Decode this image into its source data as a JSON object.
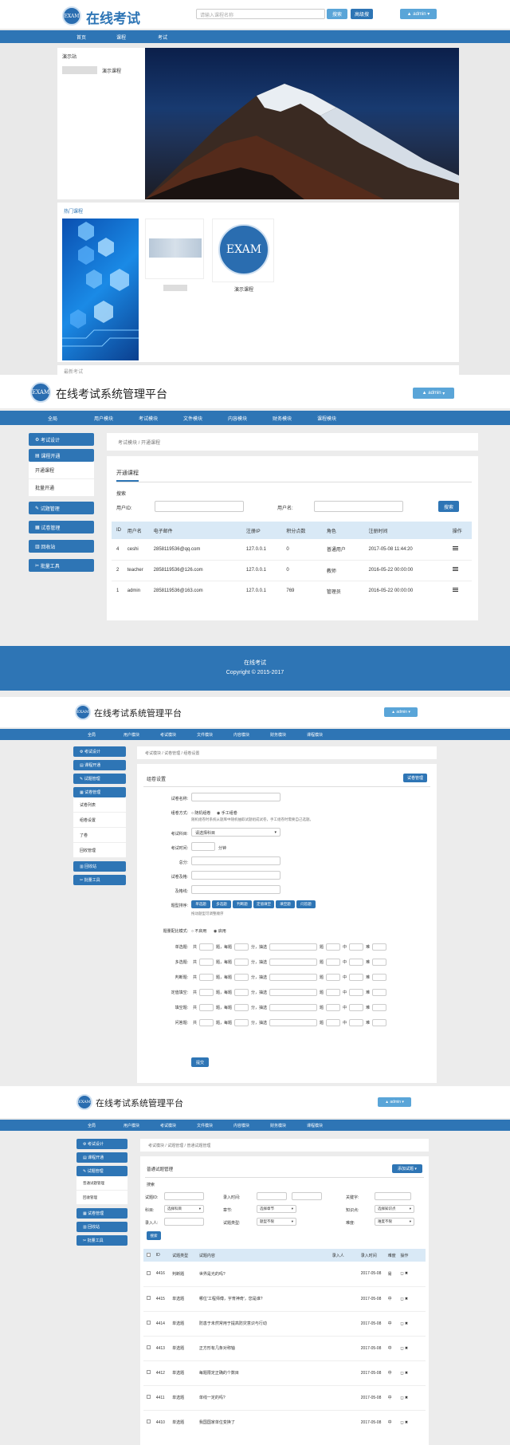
{
  "site": {
    "logo_text": "EXAM",
    "name": "在线考试",
    "search_placeholder": "请输入课程名称",
    "search_btn": "搜索",
    "search_btn2": "高级搜",
    "user_btn": "admin",
    "nav": [
      "首页",
      "课程",
      "考试"
    ],
    "sidebar_title": "演示站",
    "sidebar_item": "演示课程",
    "featured_title": "热门课程",
    "course_caption": "演示课程",
    "footer_cut": "最新考试"
  },
  "admin": {
    "logo_text": "EXAM",
    "title": "在线考试系统管理平台",
    "user_btn": "admin",
    "nav": [
      "全局",
      "用户模块",
      "考试模块",
      "文件模块",
      "内容模块",
      "财务模块",
      "课程模块"
    ],
    "sidebar": [
      "考试设计",
      "课程开通",
      "开通课程",
      "批量开通",
      "试题管理",
      "试卷管理",
      "回收站",
      "批量工具"
    ],
    "breadcrumb": "考试模块  /  开通课程",
    "tab": "开通课程",
    "search_title": "搜索",
    "label_uid": "用户ID:",
    "label_uname": "用户名:",
    "search_btn": "搜索",
    "table": {
      "headers": [
        "ID",
        "用户名",
        "电子邮件",
        "注册IP",
        "积分点数",
        "角色",
        "注册时间",
        "操作"
      ],
      "rows": [
        [
          "4",
          "ceshi",
          "2858119536@qq.com",
          "127.0.0.1",
          "0",
          "普通用户",
          "2017-05-08 11:44:20"
        ],
        [
          "2",
          "teacher",
          "2858119536@126.com",
          "127.0.0.1",
          "0",
          "教师",
          "2016-05-22 00:00:00"
        ],
        [
          "1",
          "admin",
          "2858119536@163.com",
          "127.0.0.1",
          "769",
          "管理员",
          "2016-05-22 00:00:00"
        ]
      ]
    },
    "footer_title": "在线考试",
    "footer_copy": "Copyright © 2015-2017"
  },
  "paper": {
    "sidebar": [
      "考试设计",
      "课程开通",
      "试题管理",
      "试卷管理",
      "试卷列表",
      "组卷设置",
      "了卷",
      "回收管理",
      "回收站",
      "批量工具"
    ],
    "breadcrumb": "考试模块  /  试卷管理  /  组卷设置",
    "tab": "组卷设置",
    "back_btn": "试卷管理",
    "labels": [
      "试卷名称:",
      "组卷方式:",
      "考试科目:",
      "考试时间:",
      "总分:",
      "试卷及格:",
      "及格线:",
      "题型排序:"
    ],
    "mode_opts": [
      "随机组卷",
      "手工组卷"
    ],
    "mode_hint": "随机组卷时系统从题库中随机抽取试题组成试卷，手工组卷时需要自己选题。",
    "subject_value": "请选择科目",
    "time_unit": "分钟",
    "type_chips": [
      "单选题",
      "多选题",
      "判断题",
      "定值填空",
      "填空题",
      "问答题"
    ],
    "type_hint": "拖动题型可调整顺序",
    "score_label": "题量配比模式:",
    "score_opts": [
      "不启用",
      "启用"
    ],
    "rows": [
      "单选题:",
      "多选题:",
      "判断题:",
      "定值填空:",
      "填空题:",
      "问答题:"
    ],
    "row_words": [
      "共",
      "题，每题",
      "分，抽选",
      "题",
      "中",
      "难"
    ],
    "submit": "提交"
  },
  "question": {
    "breadcrumb": "考试模块  /  试题管理  /  普通试题管理",
    "tab": "普通试题管理",
    "add_btn": "添加试题",
    "search_title": "搜索",
    "filters": [
      "试题ID:",
      "录入时间:",
      "关键字:",
      "科目:",
      "章节:",
      "知识点:",
      "录入人:",
      "试题类型:",
      "难度:"
    ],
    "selects": [
      "选择科目",
      "选择章节",
      "选择知识点",
      "题型不限",
      "难度不限"
    ],
    "search_btn": "搜索",
    "headers": [
      "ID",
      "试题类型",
      "试题内容",
      "录入人",
      "录入时间",
      "难度",
      "操作"
    ],
    "rows": [
      [
        "4416",
        "判断题",
        "世界是光的吗?",
        "2017-05-08",
        "易"
      ],
      [
        "4415",
        "单选题",
        "哪位'工程师傅，字育神奇'，您是谁?",
        "2017-05-08",
        "中"
      ],
      [
        "4414",
        "单选题",
        "防患于未然常用于提高防灾意识与行动",
        "2017-05-08",
        "中"
      ],
      [
        "4413",
        "单选题",
        "正方形有几条对称轴",
        "2017-05-08",
        "中"
      ],
      [
        "4412",
        "单选题",
        "每题限定正确的个数目",
        "2017-05-08",
        "中"
      ],
      [
        "4411",
        "单选题",
        "单线一定的吗?",
        "2017-05-08",
        "中"
      ],
      [
        "4410",
        "单选题",
        "我国国家单位变换了",
        "2017-05-08",
        "中"
      ]
    ]
  }
}
